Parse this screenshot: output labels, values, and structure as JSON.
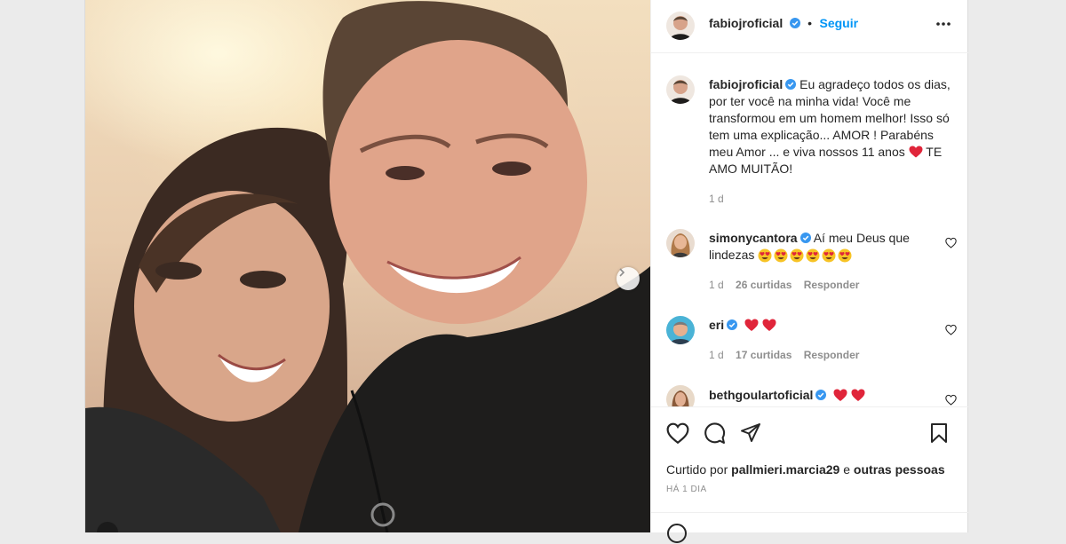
{
  "post": {
    "username": "fabiojroficial",
    "follow_label": "Seguir",
    "separator": "•",
    "caption": "Eu agradeço todos os dias, por ter você na minha vida! Você me transformou em um homem melhor! Isso só tem uma explicação... AMOR ! Parabéns meu Amor ... e viva nossos 11 anos",
    "caption_end": "TE AMO MUITÃO!",
    "caption_time": "1 d"
  },
  "comments": [
    {
      "username": "simonycantora",
      "text": "Aí meu Deus que lindezas",
      "emoji_count": 6,
      "time": "1 d",
      "likes": "26 curtidas",
      "reply": "Responder"
    },
    {
      "username": "eri",
      "time": "1 d",
      "likes": "17 curtidas",
      "reply": "Responder"
    },
    {
      "username": "bethgoulartoficial"
    }
  ],
  "footer": {
    "liked_prefix": "Curtido por",
    "liked_user": "pallmieri.marcia29",
    "liked_suffix": "e",
    "liked_others": "outras pessoas",
    "when": "HÁ 1 DIA"
  },
  "icons": [
    "more-icon",
    "verified-icon",
    "heart-icon",
    "comment-icon",
    "share-icon",
    "save-icon",
    "chevron-right-icon"
  ],
  "colors": {
    "accent": "#0095f6",
    "heart": "#ed4956",
    "verified": "#3897f0"
  }
}
